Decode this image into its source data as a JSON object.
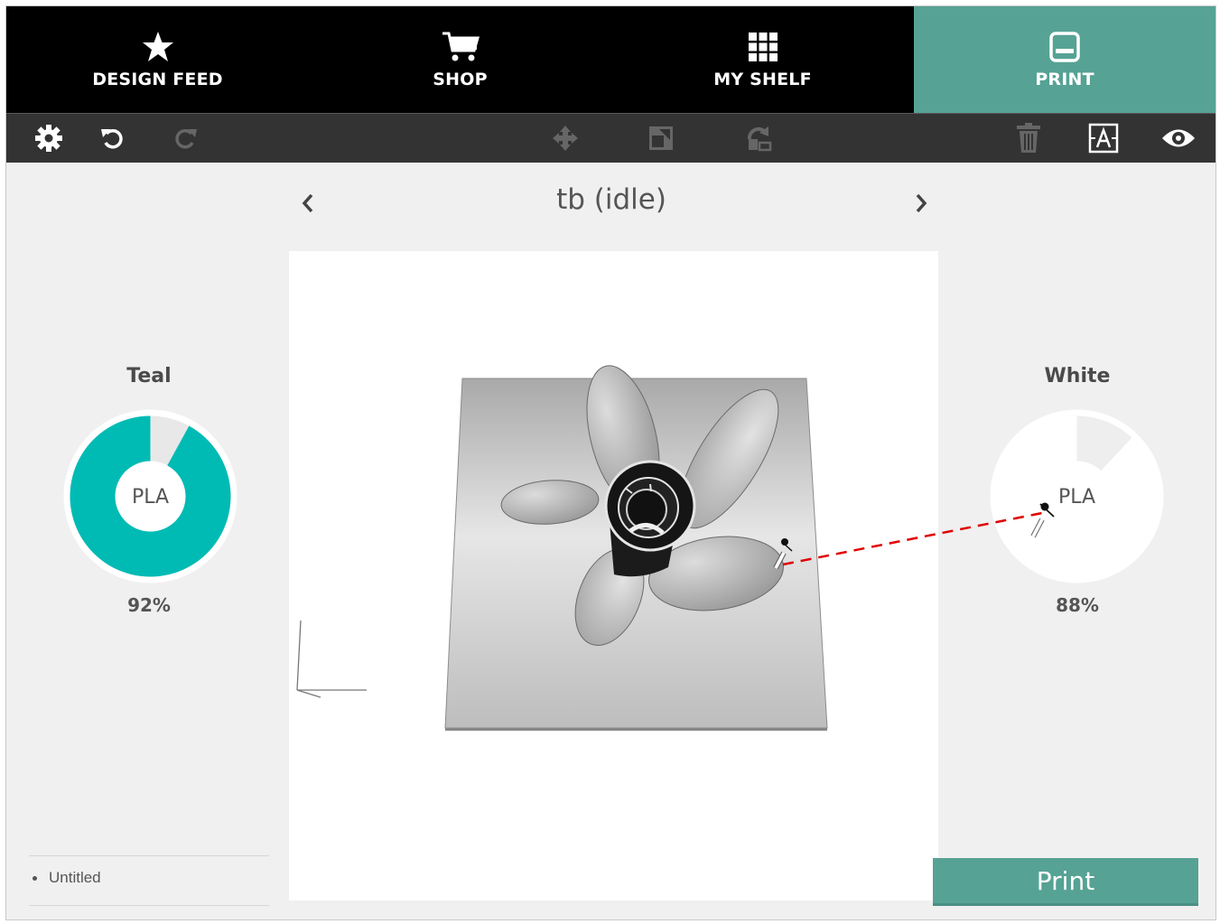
{
  "nav": {
    "tabs": [
      {
        "label": "DESIGN FEED",
        "icon": "star-icon"
      },
      {
        "label": "SHOP",
        "icon": "cart-icon"
      },
      {
        "label": "MY SHELF",
        "icon": "grid-icon"
      },
      {
        "label": "PRINT",
        "icon": "printer-icon",
        "active": true
      }
    ],
    "active_color": "#56a294"
  },
  "toolbar": {
    "left": [
      "gear-icon",
      "undo-icon",
      "redo-icon"
    ],
    "center": [
      "move-icon",
      "scale-icon",
      "rotate-icon"
    ],
    "right": [
      "trash-icon",
      "label-icon",
      "eye-icon"
    ]
  },
  "printer": {
    "name": "tb (idle)"
  },
  "filaments": {
    "left": {
      "name": "Teal",
      "material": "PLA",
      "percent_label": "92%",
      "fraction": 0.92,
      "color": "#00bbb4"
    },
    "right": {
      "name": "White",
      "material": "PLA",
      "percent_label": "88%",
      "fraction": 0.88,
      "color": "#ffffff"
    }
  },
  "files": {
    "items": [
      "Untitled"
    ]
  },
  "actions": {
    "print_label": "Print"
  },
  "annotation": {
    "line_color": "#e00000"
  }
}
